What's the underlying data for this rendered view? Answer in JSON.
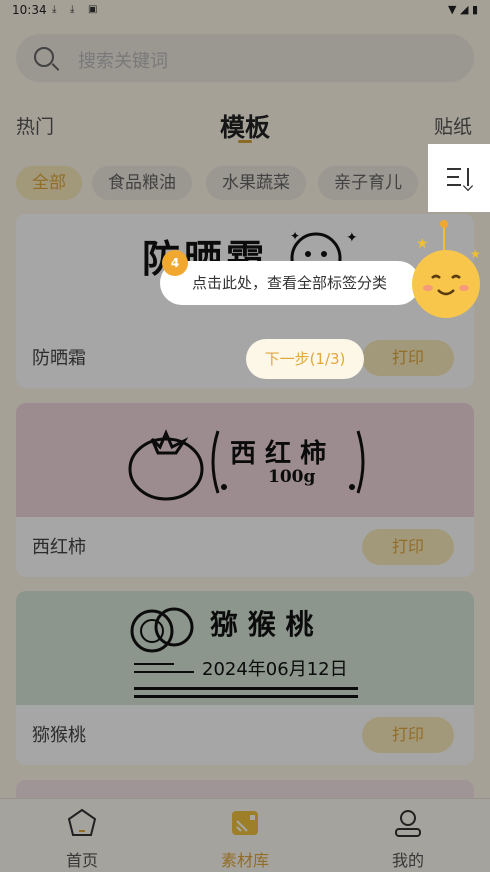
{
  "status_bar": {
    "time": "10:34"
  },
  "search": {
    "placeholder": "搜索关键词"
  },
  "tabs": [
    {
      "label": "热门"
    },
    {
      "label": "模板"
    },
    {
      "label": "贴纸"
    }
  ],
  "chips": [
    {
      "label": "全部"
    },
    {
      "label": "食品粮油"
    },
    {
      "label": "水果蔬菜"
    },
    {
      "label": "亲子育儿"
    }
  ],
  "cards": [
    {
      "name": "防晒霜",
      "image_text": "防晒霜",
      "print_label": "打印",
      "bg": "#ffffff"
    },
    {
      "name": "西红柿",
      "image_text": "西 红 柿",
      "image_subtext": "100g",
      "print_label": "打印",
      "bg": "#f0d7dc"
    },
    {
      "name": "猕猴桃",
      "image_text": "猕 猴 桃",
      "image_date": "2024年06月12日",
      "print_label": "打印",
      "bg": "#d8e6d8"
    }
  ],
  "guide": {
    "tip": "点击此处，查看全部标签分类",
    "next_label": "下一步(1/3)"
  },
  "bottom_nav": [
    {
      "label": "首页"
    },
    {
      "label": "素材库"
    },
    {
      "label": "我的"
    }
  ],
  "colors": {
    "accent": "#e0a83e",
    "chip_active_bg": "#f9ebbd"
  }
}
